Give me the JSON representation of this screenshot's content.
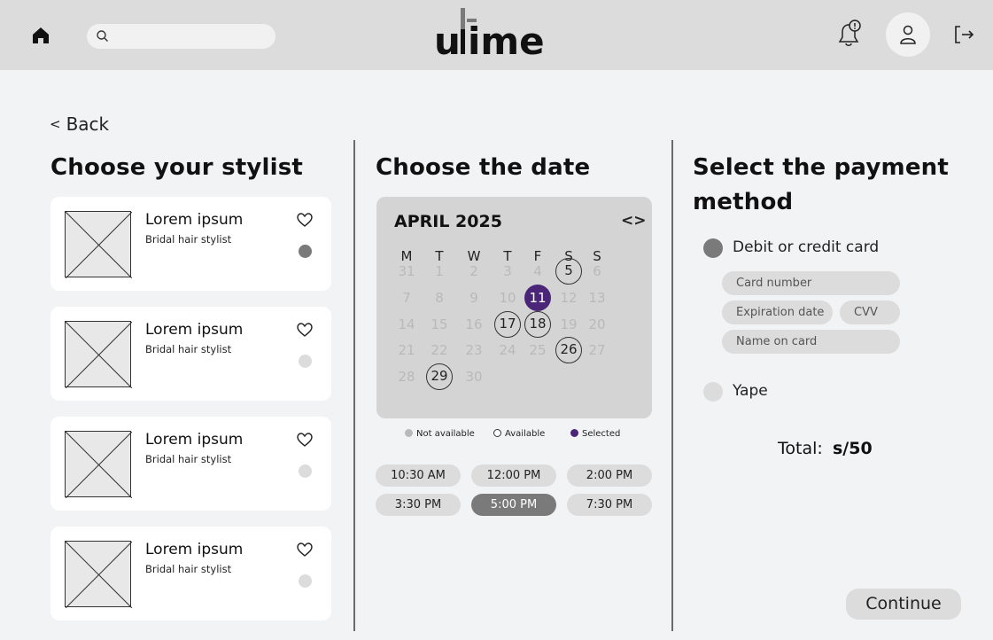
{
  "header": {
    "logo_text": "uLime",
    "search_placeholder": "",
    "home_icon": "home-icon",
    "search_icon": "search-icon",
    "bell_icon": "notification-bell-icon",
    "user_icon": "user-icon",
    "logout_icon": "logout-icon"
  },
  "nav": {
    "back_label": "Back"
  },
  "stylists": {
    "title": "Choose your stylist",
    "items": [
      {
        "name": "Lorem ipsum",
        "role": "Bridal hair stylist",
        "selected": true
      },
      {
        "name": "Lorem ipsum",
        "role": "Bridal hair stylist",
        "selected": false
      },
      {
        "name": "Lorem ipsum",
        "role": "Bridal hair stylist",
        "selected": false
      },
      {
        "name": "Lorem ipsum",
        "role": "Bridal hair stylist",
        "selected": false
      }
    ]
  },
  "date": {
    "title": "Choose the date",
    "month": "APRIL 2025",
    "nav": "<>",
    "weekdays": [
      "M",
      "T",
      "W",
      "T",
      "F",
      "S",
      "S"
    ],
    "weeks": [
      [
        "31",
        "1",
        "2",
        "3",
        "4",
        "5",
        "6"
      ],
      [
        "7",
        "8",
        "9",
        "10",
        "11",
        "12",
        "13"
      ],
      [
        "14",
        "15",
        "16",
        "17",
        "18",
        "19",
        "20"
      ],
      [
        "21",
        "22",
        "23",
        "24",
        "25",
        "26",
        "27"
      ],
      [
        "28",
        "29",
        "30"
      ]
    ],
    "available_days": [
      "5",
      "17",
      "18",
      "26",
      "29"
    ],
    "selected_day": "11",
    "legend": {
      "not_available": "Not available",
      "available": "Available",
      "selected": "Selected"
    },
    "times": [
      "10:30 AM",
      "12:00 PM",
      "2:00 PM",
      "3:30 PM",
      "5:00 PM",
      "7:30 PM"
    ],
    "selected_time": "5:00 PM"
  },
  "payment": {
    "title_line1": "Select the payment",
    "title_line2": "method",
    "card_option": "Debit or credit card",
    "card_number_placeholder": "Card number",
    "expiration_placeholder": "Expiration date",
    "cvv_placeholder": "CVV",
    "name_placeholder": "Name on card",
    "yape_option": "Yape",
    "total_label": "Total:",
    "total_value": "s/50",
    "continue_label": "Continue"
  },
  "colors": {
    "topbar": "#dcdcdc",
    "background": "#f2f3f5",
    "selected_accent": "#4b2577",
    "active_gray": "#7a7a7a"
  }
}
